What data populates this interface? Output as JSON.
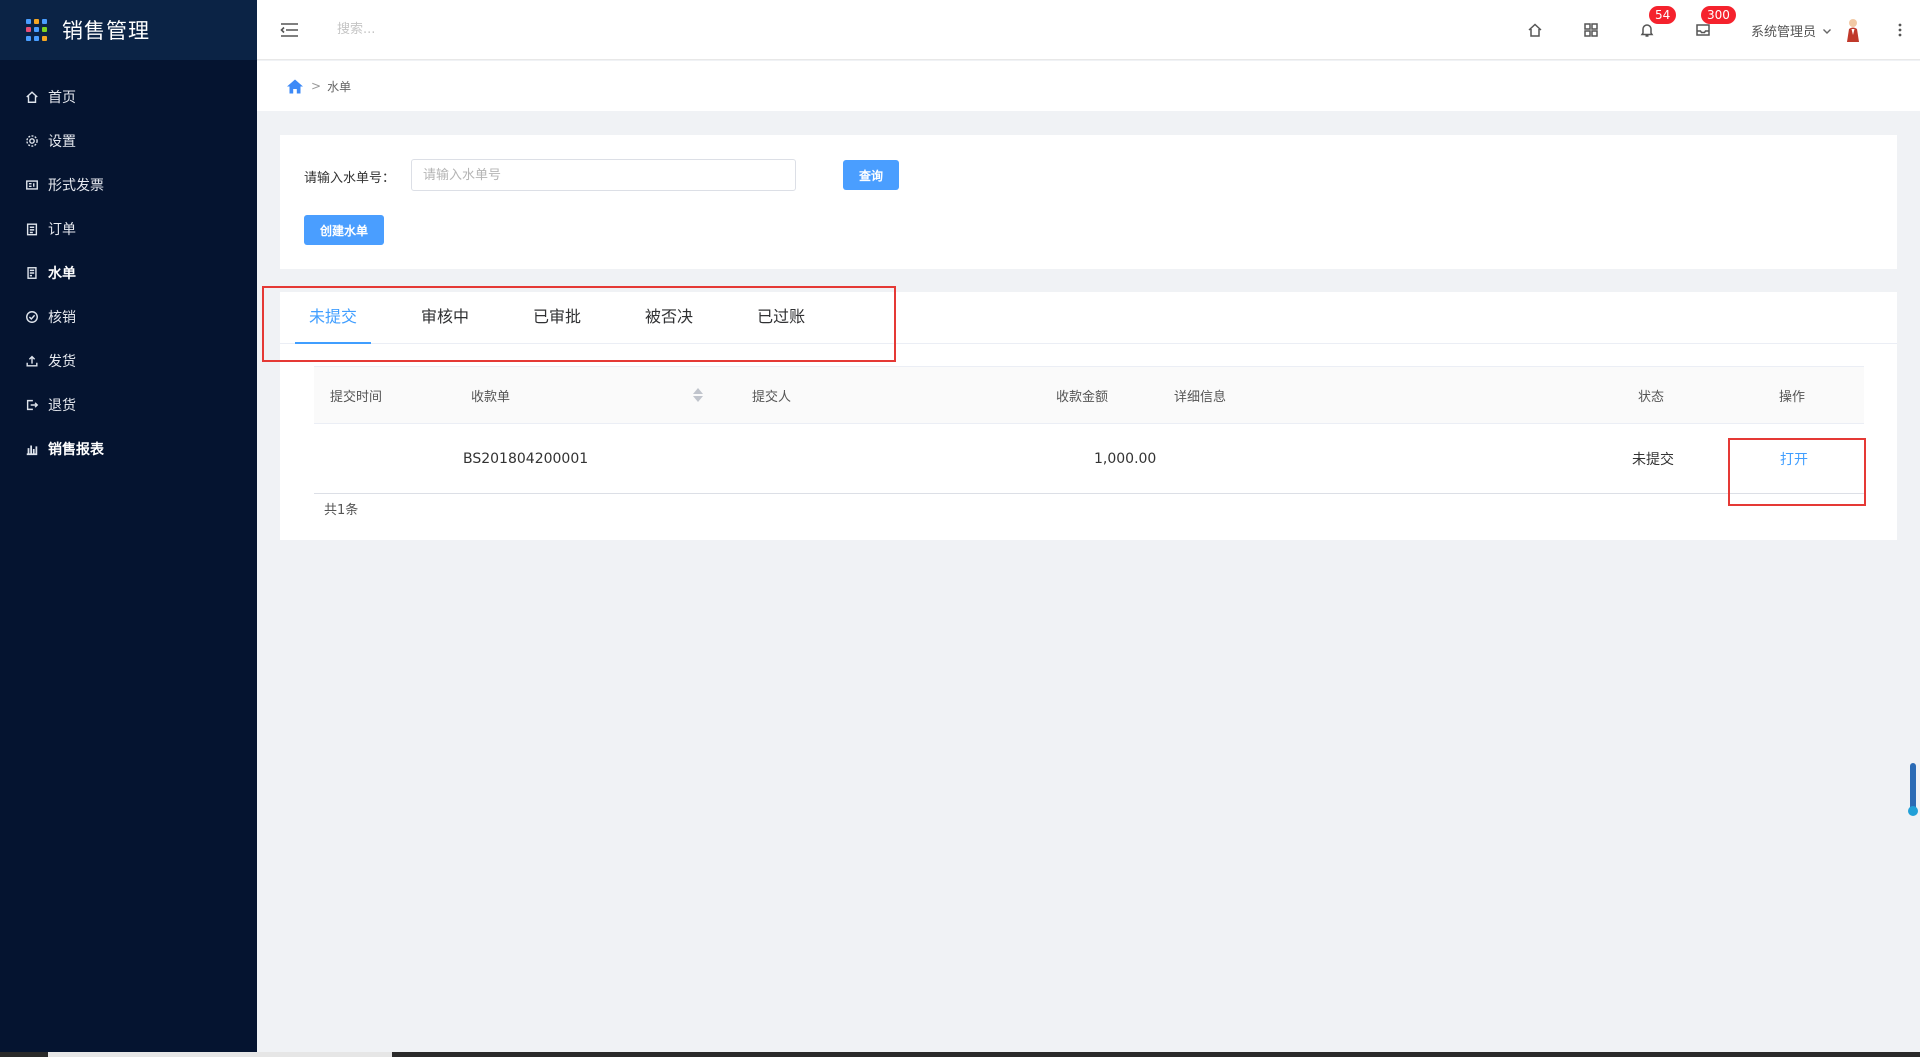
{
  "app": {
    "title": "销售管理"
  },
  "colors": {
    "sidebar_bg": "#051430",
    "accent": "#409eff",
    "badge": "#f5222d",
    "annotation": "#e53935"
  },
  "sidebar": {
    "items": [
      {
        "label": "首页",
        "icon": "home-icon"
      },
      {
        "label": "设置",
        "icon": "gear-icon"
      },
      {
        "label": "形式发票",
        "icon": "invoice-icon"
      },
      {
        "label": "订单",
        "icon": "clipboard-icon"
      },
      {
        "label": "水单",
        "icon": "document-icon",
        "active": true
      },
      {
        "label": "核销",
        "icon": "check-circle-icon"
      },
      {
        "label": "发货",
        "icon": "upload-icon"
      },
      {
        "label": "退货",
        "icon": "logout-icon"
      },
      {
        "label": "销售报表",
        "icon": "bar-chart-icon"
      }
    ]
  },
  "header": {
    "search_placeholder": "搜索...",
    "notifications_count": "54",
    "messages_count": "300",
    "user_name": "系统管理员"
  },
  "breadcrumb": {
    "current": "水单",
    "separator": ">"
  },
  "query": {
    "label": "请输入水单号：",
    "input_placeholder": "请输入水单号",
    "search_button": "查询",
    "create_button": "创建水单"
  },
  "tabs": [
    {
      "label": "未提交",
      "active": true
    },
    {
      "label": "审核中"
    },
    {
      "label": "已审批"
    },
    {
      "label": "被否决"
    },
    {
      "label": "已过账"
    }
  ],
  "table": {
    "columns": [
      "提交时间",
      "收款单",
      "提交人",
      "收款金额",
      "详细信息",
      "状态",
      "操作"
    ],
    "rows": [
      {
        "time": "",
        "receipt": "BS201804200001",
        "submitter": "",
        "amount": "1,000.00",
        "details": "",
        "status": "未提交",
        "action": "打开"
      }
    ],
    "total": "共1条"
  }
}
